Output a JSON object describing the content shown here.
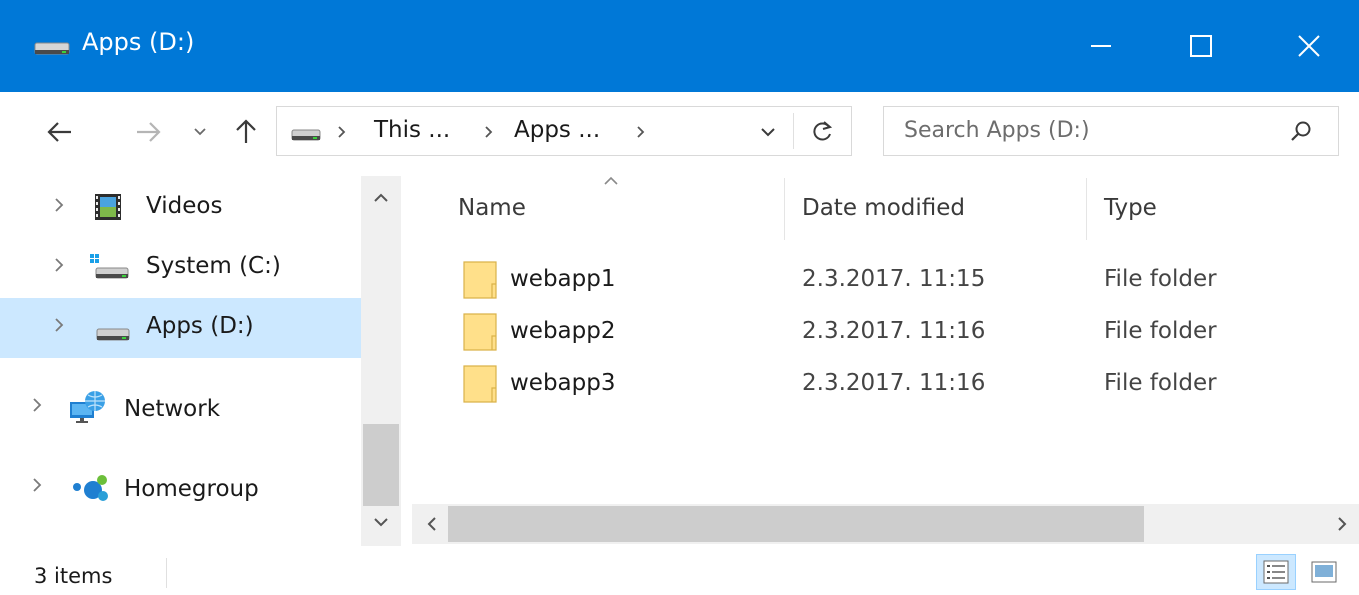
{
  "window": {
    "title": "Apps (D:)",
    "accent_color": "#0078d7",
    "controls": [
      "minimize-icon",
      "maximize-icon",
      "close-icon"
    ]
  },
  "nav": {
    "back_icon": "arrow-left-icon",
    "forward_icon": "arrow-right-icon",
    "recent_icon": "chevron-down-icon",
    "up_icon": "arrow-up-icon",
    "breadcrumb": [
      "This ...",
      "Apps ..."
    ],
    "refresh_icon": "refresh-icon",
    "search_placeholder": "Search Apps (D:)"
  },
  "nav_pane": {
    "items": [
      {
        "label": "Videos",
        "icon": "videos-folder-icon",
        "selected": false
      },
      {
        "label": "System (C:)",
        "icon": "system-drive-icon",
        "selected": false
      },
      {
        "label": "Apps (D:)",
        "icon": "drive-icon",
        "selected": true
      },
      {
        "label": "Network",
        "icon": "network-icon",
        "selected": false
      },
      {
        "label": "Homegroup",
        "icon": "homegroup-icon",
        "selected": false
      }
    ]
  },
  "file_list": {
    "columns": [
      "Name",
      "Date modified",
      "Type"
    ],
    "sort_column": "Name",
    "rows": [
      {
        "name": "webapp1",
        "date": "2.3.2017. 11:15",
        "type": "File folder"
      },
      {
        "name": "webapp2",
        "date": "2.3.2017. 11:16",
        "type": "File folder"
      },
      {
        "name": "webapp3",
        "date": "2.3.2017. 11:16",
        "type": "File folder"
      }
    ]
  },
  "status": {
    "item_count": "3 items",
    "view_icons": [
      "details-view-icon",
      "large-icons-view-icon"
    ]
  }
}
